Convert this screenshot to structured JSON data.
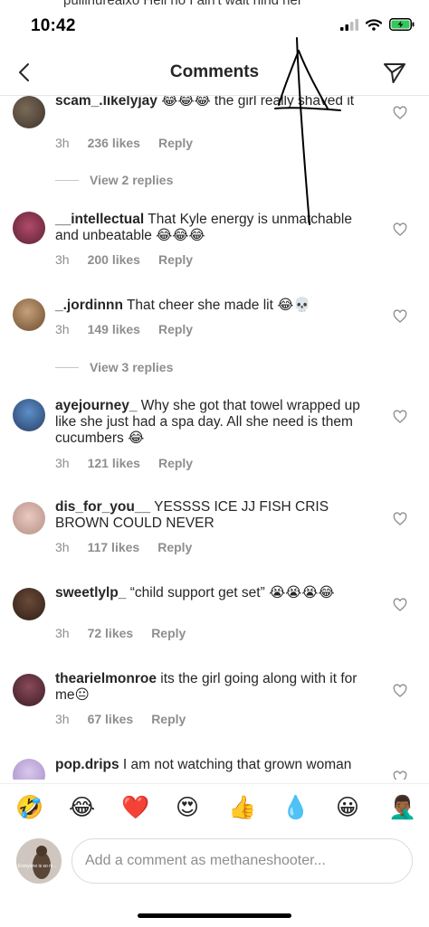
{
  "status_bar": {
    "time": "10:42",
    "cut_off_text": "pullinurealxo Hell no I ain't wait hind her"
  },
  "header": {
    "title": "Comments"
  },
  "comments": [
    {
      "user": "scam_.likelyjay",
      "text": "😂😂😂 the girl really shaved it",
      "time": "3h",
      "likes": "236 likes",
      "reply": "Reply",
      "view_replies": "View 2 replies"
    },
    {
      "user": "__intellectual",
      "text": "That Kyle energy is unmatchable and unbeatable 😂😂😂",
      "time": "3h",
      "likes": "200 likes",
      "reply": "Reply"
    },
    {
      "user": "_.jordinnn",
      "text": "That cheer she made lit 😂💀",
      "time": "3h",
      "likes": "149 likes",
      "reply": "Reply",
      "view_replies": "View 3 replies"
    },
    {
      "user": "ayejourney_",
      "text": "Why she got that towel wrapped up like she just had a spa day. All she need is them cucumbers 😂",
      "time": "3h",
      "likes": "121 likes",
      "reply": "Reply"
    },
    {
      "user": "dis_for_you__",
      "text": "YESSSS ICE JJ FISH CRIS BROWN COULD NEVER",
      "time": "3h",
      "likes": "117 likes",
      "reply": "Reply"
    },
    {
      "user": "sweetlylp_",
      "text": "“child support get set” 😭😭😭😂",
      "time": "3h",
      "likes": "72 likes",
      "reply": "Reply"
    },
    {
      "user": "thearielmonroe",
      "text": "its the girl going along with it for me😐",
      "time": "3h",
      "likes": "67 likes",
      "reply": "Reply"
    },
    {
      "user": "pop.drips",
      "text": "I am not watching that grown woman",
      "time": "",
      "likes": "",
      "reply": ""
    }
  ],
  "quick_emojis": [
    {
      "char": "🤣",
      "icon": "rofl-emoji-icon"
    },
    {
      "char": "😂",
      "icon": "tears-of-joy-emoji-icon"
    },
    {
      "char": "❤️",
      "icon": "red-heart-emoji-icon"
    },
    {
      "char": "😍",
      "icon": "heart-eyes-emoji-icon"
    },
    {
      "char": "👍",
      "icon": "thumbs-up-emoji-icon"
    },
    {
      "char": "💧",
      "icon": "droplet-emoji-icon"
    },
    {
      "char": "😀",
      "icon": "grinning-emoji-icon"
    },
    {
      "char": "🤦🏾‍♂️",
      "icon": "facepalm-emoji-icon"
    }
  ],
  "composer": {
    "placeholder": "Add a comment as methaneshooter...",
    "avatar_caption": "Everyone is so m..."
  },
  "colors": {
    "text": "#262626",
    "secondary": "#8e8e8e",
    "divider": "#dbdbdb",
    "battery": "#34c759"
  }
}
